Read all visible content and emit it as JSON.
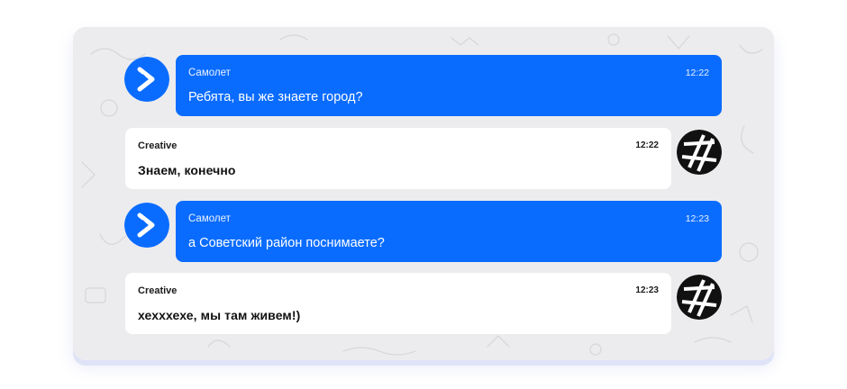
{
  "colors": {
    "accent": "#0a6cff",
    "background": "#ececee",
    "bubble_light": "#ffffff"
  },
  "messages": [
    {
      "sender": "Самолет",
      "time": "12:22",
      "text": "Ребята, вы же знаете город?",
      "side": "left",
      "avatar": "samolet-logo-icon"
    },
    {
      "sender": "Creative",
      "time": "12:22",
      "text": "Знаем, конечно",
      "side": "right",
      "avatar": "creative-logo-icon"
    },
    {
      "sender": "Самолет",
      "time": "12:23",
      "text": "а Советский район поснимаете?",
      "side": "left",
      "avatar": "samolet-logo-icon"
    },
    {
      "sender": "Creative",
      "time": "12:23",
      "text": "хехххехе, мы там живем!)",
      "side": "right",
      "avatar": "creative-logo-icon"
    }
  ]
}
